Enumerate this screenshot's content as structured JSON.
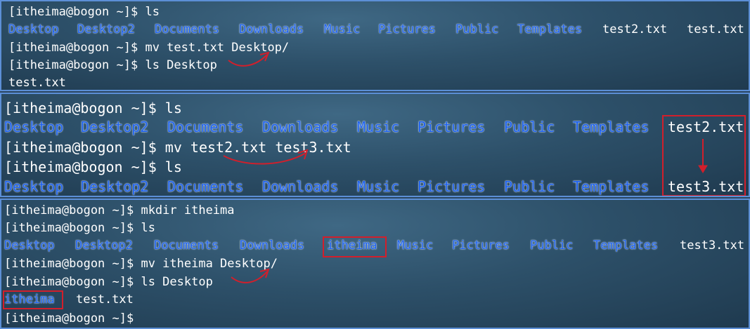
{
  "colors": {
    "dir": "#1f62ee",
    "text": "#ffffff",
    "annotation": "#d21f2b",
    "border": "#5c8fd6"
  },
  "panel1": {
    "lines": [
      "[itheima@bogon ~]$ ls",
      "",
      "[itheima@bogon ~]$ mv test.txt Desktop/",
      "[itheima@bogon ~]$ ls Desktop",
      "test.txt"
    ],
    "listing": [
      {
        "text": "Desktop",
        "type": "dir"
      },
      {
        "text": "Desktop2",
        "type": "dir"
      },
      {
        "text": "Documents",
        "type": "dir"
      },
      {
        "text": "Downloads",
        "type": "dir"
      },
      {
        "text": "Music",
        "type": "dir"
      },
      {
        "text": "Pictures",
        "type": "dir"
      },
      {
        "text": "Public",
        "type": "dir"
      },
      {
        "text": "Templates",
        "type": "dir"
      },
      {
        "text": "test2.txt",
        "type": "file"
      },
      {
        "text": "test.txt",
        "type": "file"
      }
    ]
  },
  "panel2": {
    "lines": [
      "[itheima@bogon ~]$ ls",
      "",
      "[itheima@bogon ~]$ mv test2.txt test3.txt",
      "[itheima@bogon ~]$ ls"
    ],
    "listing1": [
      {
        "text": "Desktop",
        "type": "dir"
      },
      {
        "text": "Desktop2",
        "type": "dir"
      },
      {
        "text": "Documents",
        "type": "dir"
      },
      {
        "text": "Downloads",
        "type": "dir"
      },
      {
        "text": "Music",
        "type": "dir"
      },
      {
        "text": "Pictures",
        "type": "dir"
      },
      {
        "text": "Public",
        "type": "dir"
      },
      {
        "text": "Templates",
        "type": "dir"
      },
      {
        "text": "test2.txt",
        "type": "file"
      }
    ],
    "listing2": [
      {
        "text": "Desktop",
        "type": "dir"
      },
      {
        "text": "Desktop2",
        "type": "dir"
      },
      {
        "text": "Documents",
        "type": "dir"
      },
      {
        "text": "Downloads",
        "type": "dir"
      },
      {
        "text": "Music",
        "type": "dir"
      },
      {
        "text": "Pictures",
        "type": "dir"
      },
      {
        "text": "Public",
        "type": "dir"
      },
      {
        "text": "Templates",
        "type": "dir"
      },
      {
        "text": "test3.txt",
        "type": "file"
      }
    ]
  },
  "panel3": {
    "lines": [
      "[itheima@bogon ~]$ mkdir itheima",
      "[itheima@bogon ~]$ ls",
      "",
      "[itheima@bogon ~]$ mv itheima Desktop/",
      "[itheima@bogon ~]$ ls Desktop",
      "",
      "[itheima@bogon ~]$"
    ],
    "listing1": [
      {
        "text": "Desktop",
        "type": "dir"
      },
      {
        "text": "Desktop2",
        "type": "dir"
      },
      {
        "text": "Documents",
        "type": "dir"
      },
      {
        "text": "Downloads",
        "type": "dir"
      },
      {
        "text": "itheima",
        "type": "dir"
      },
      {
        "text": "Music",
        "type": "dir"
      },
      {
        "text": "Pictures",
        "type": "dir"
      },
      {
        "text": "Public",
        "type": "dir"
      },
      {
        "text": "Templates",
        "type": "dir"
      },
      {
        "text": "test3.txt",
        "type": "file"
      }
    ],
    "listing2": [
      {
        "text": "itheima",
        "type": "dir"
      },
      {
        "text": "test.txt",
        "type": "file"
      }
    ]
  }
}
